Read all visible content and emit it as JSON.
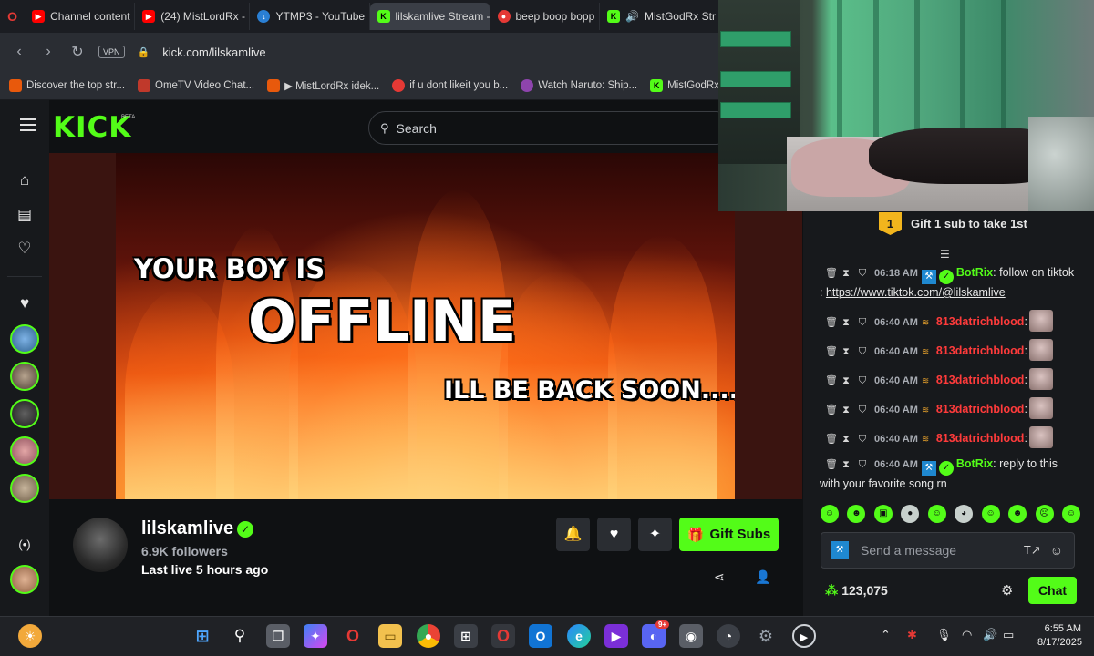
{
  "browser": {
    "tabs": [
      {
        "label": "Channel content",
        "icon": "youtube-icon",
        "color": "#ff0000"
      },
      {
        "label": "(24) MistLordRx -",
        "icon": "youtube-icon",
        "color": "#ff0000"
      },
      {
        "label": "YTMP3 - YouTube",
        "icon": "ytmp3-icon",
        "color": "#2a7fd4"
      },
      {
        "label": "lilskamlive Stream - Watch",
        "icon": "kick-icon",
        "color": "#53fc18",
        "active": true
      },
      {
        "label": "beep boop bopp",
        "icon": "recording-icon",
        "color": "#e53935"
      },
      {
        "label": "MistGodRx Str",
        "icon": "kick-icon",
        "color": "#53fc18"
      }
    ],
    "url": "kick.com/lilskamlive",
    "vpn_label": "VPN",
    "bookmarks": [
      {
        "label": "Discover the top str...",
        "color": "#e8590c"
      },
      {
        "label": "OmeTV Video Chat...",
        "color": "#c0392b"
      },
      {
        "label": "▶ MistLordRx idek...",
        "color": "#e8590c"
      },
      {
        "label": "if u dont likeit you b...",
        "color": "#e53935"
      },
      {
        "label": "Watch Naruto: Ship...",
        "color": "#8e44ad"
      },
      {
        "label": "MistGodRx",
        "color": "#53fc18"
      }
    ]
  },
  "kick": {
    "logo": "KICK",
    "beta": "BETA",
    "search_placeholder": "Search",
    "accent": "#53fc18"
  },
  "video": {
    "line1": "YOUR BOY IS",
    "line2": "OFFLINE",
    "line3": "ILL BE BACK SOON...."
  },
  "channel": {
    "name": "lilskamlive",
    "followers": "6.9K followers",
    "last_live": "Last live 5 hours ago",
    "gift_subs_label": "Gift Subs"
  },
  "chat": {
    "gift_banner": "Gift 1 sub to take 1st",
    "gift_badge_number": "1",
    "messages": [
      {
        "time": "06:18 AM",
        "user": "BotRix",
        "type": "bot",
        "text": "follow on tiktok : ",
        "link": "https://www.tiktok.com/@lilskamlive"
      },
      {
        "time": "06:40 AM",
        "user": "813datrichblood",
        "type": "user",
        "text": ""
      },
      {
        "time": "06:40 AM",
        "user": "813datrichblood",
        "type": "user",
        "text": ""
      },
      {
        "time": "06:40 AM",
        "user": "813datrichblood",
        "type": "user",
        "text": ""
      },
      {
        "time": "06:40 AM",
        "user": "813datrichblood",
        "type": "user",
        "text": ""
      },
      {
        "time": "06:40 AM",
        "user": "813datrichblood",
        "type": "user",
        "text": ""
      },
      {
        "time": "06:40 AM",
        "user": "BotRix",
        "type": "bot",
        "text": "reply to this with your favorite song rn",
        "link": ""
      }
    ],
    "send_placeholder": "Send a message",
    "points": "123,075",
    "chat_button": "Chat"
  },
  "taskbar": {
    "time": "6:55 AM",
    "date": "8/17/2025",
    "notification_badge": "9+"
  }
}
